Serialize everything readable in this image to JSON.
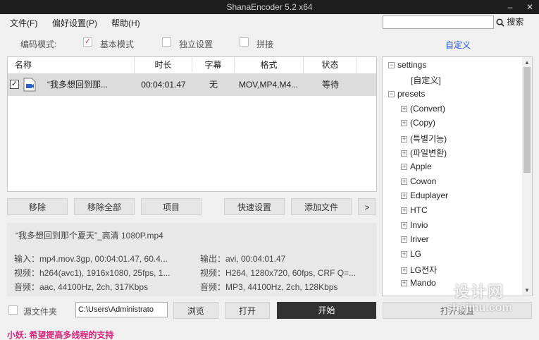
{
  "window": {
    "title": "ShanaEncoder 5.2 x64",
    "minimize": "–",
    "close": "✕"
  },
  "menu": [
    "文件(F)",
    "偏好设置(P)",
    "帮助(H)"
  ],
  "search": {
    "value": "",
    "button_label": "搜索",
    "icon": "search-icon"
  },
  "mode": {
    "label": "编码模式:",
    "options": [
      {
        "label": "基本模式",
        "checked": true
      },
      {
        "label": "独立设置",
        "checked": false
      },
      {
        "label": "拼接",
        "checked": false
      }
    ],
    "custom_link": "自定义"
  },
  "table": {
    "headers": [
      "名称",
      "时长",
      "字幕",
      "格式",
      "状态"
    ],
    "rows": [
      {
        "checked": true,
        "name": "“我多想回到那...",
        "duration": "00:04:01.47",
        "subtitle": "无",
        "format": "MOV,MP4,M4...",
        "status": "等待"
      }
    ]
  },
  "buttons": {
    "remove": "移除",
    "remove_all": "移除全部",
    "item": "项目",
    "quick_settings": "快速设置",
    "add_file": "添加文件",
    "more": ">"
  },
  "info": {
    "filename": "“我多想回到那个夏天”_高清 1080P.mp4",
    "input": "输入：mp4.mov.3gp, 00:04:01.47, 60.4...",
    "video_in": "视频：h264(avc1), 1916x1080, 25fps, 1...",
    "audio_in": "音频：aac, 44100Hz, 2ch, 317Kbps",
    "output": "输出：avi, 00:04:01.47",
    "video_out": "视频：H264, 1280x720, 60fps, CRF Q=...",
    "audio_out": "音频：MP3, 44100Hz, 2ch, 128Kbps"
  },
  "tree": {
    "settings": "settings",
    "custom": "[自定义]",
    "presets": "presets",
    "items": [
      "(Convert)",
      "(Copy)",
      "(특별기능)",
      "(파일변환)",
      "Apple",
      "Cowon",
      "Eduplayer",
      "HTC",
      "Invio",
      "Iriver",
      "LG",
      "LG전자",
      "Mando"
    ]
  },
  "bottom": {
    "source_folder": "源文件夹",
    "path": "C:\\Users\\Administrato",
    "browse": "浏览",
    "open": "打开",
    "start": "开始",
    "open_after": "打开设置"
  },
  "status_text": "小妖: 希望提高多线程的支持",
  "watermark": {
    "line1": "设计网",
    "line2": "shejinu.com"
  }
}
